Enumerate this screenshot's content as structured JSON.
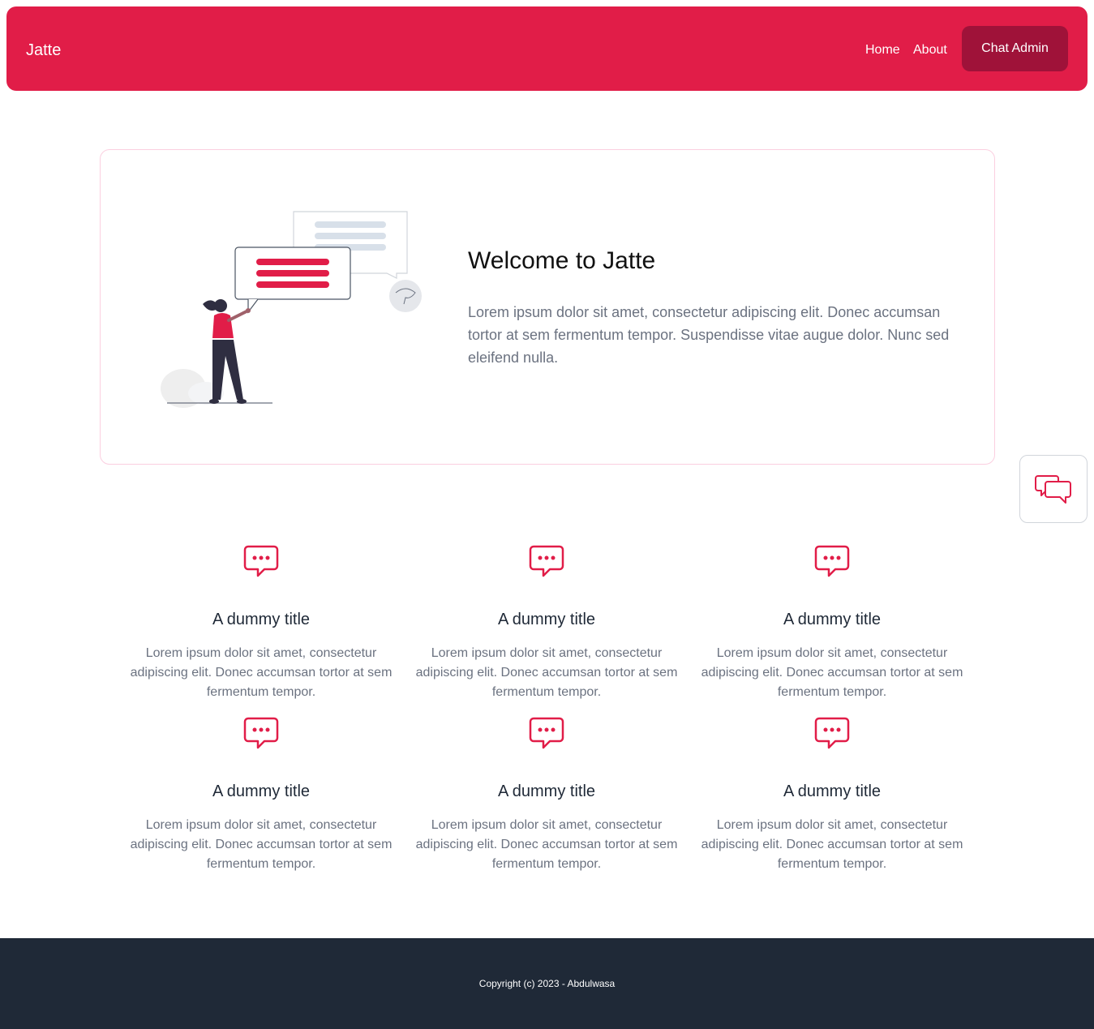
{
  "navbar": {
    "brand": "Jatte",
    "links": [
      {
        "label": "Home"
      },
      {
        "label": "About"
      }
    ],
    "cta_label": "Chat Admin",
    "bg_color": "#e11d48",
    "cta_color": "#9f1239"
  },
  "hero": {
    "title": "Welcome to Jatte",
    "text": "Lorem ipsum dolor sit amet, consectetur adipiscing elit. Donec accumsan tortor at sem fermentum tempor. Suspendisse vitae augue dolor. Nunc sed eleifend nulla.",
    "illustration": "person-with-chat-bubbles-illustration"
  },
  "floating_chat": {
    "icon": "chat-bubbles-icon"
  },
  "features": [
    {
      "icon": "chat-bubble-dots-icon",
      "title": "A dummy title",
      "text": "Lorem ipsum dolor sit amet, consectetur adipiscing elit. Donec accumsan tortor at sem fermentum tempor."
    },
    {
      "icon": "chat-bubble-dots-icon",
      "title": "A dummy title",
      "text": "Lorem ipsum dolor sit amet, consectetur adipiscing elit. Donec accumsan tortor at sem fermentum tempor."
    },
    {
      "icon": "chat-bubble-dots-icon",
      "title": "A dummy title",
      "text": "Lorem ipsum dolor sit amet, consectetur adipiscing elit. Donec accumsan tortor at sem fermentum tempor."
    },
    {
      "icon": "chat-bubble-dots-icon",
      "title": "A dummy title",
      "text": "Lorem ipsum dolor sit amet, consectetur adipiscing elit. Donec accumsan tortor at sem fermentum tempor."
    },
    {
      "icon": "chat-bubble-dots-icon",
      "title": "A dummy title",
      "text": "Lorem ipsum dolor sit amet, consectetur adipiscing elit. Donec accumsan tortor at sem fermentum tempor."
    },
    {
      "icon": "chat-bubble-dots-icon",
      "title": "A dummy title",
      "text": "Lorem ipsum dolor sit amet, consectetur adipiscing elit. Donec accumsan tortor at sem fermentum tempor."
    }
  ],
  "footer": {
    "copyright": "Copyright (c) 2023 - Abdulwasa",
    "bg_color": "#1f2937"
  }
}
